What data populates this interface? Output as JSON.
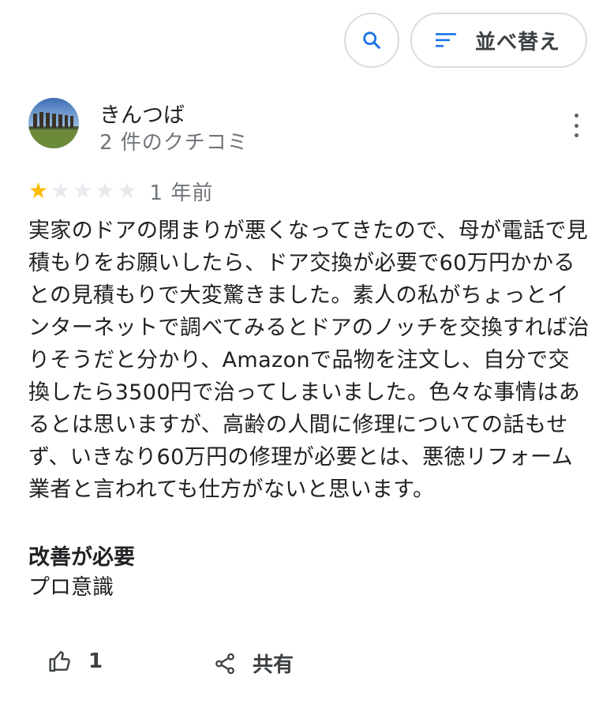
{
  "toolbar": {
    "search_icon": "search-icon",
    "sort_icon": "sort-icon",
    "sort_label": "並べ替え"
  },
  "review": {
    "reviewer_name": "きんつば",
    "review_count": "2 件のクチコミ",
    "rating": 1,
    "max_rating": 5,
    "time_ago": "1 年前",
    "text": "実家のドアの閉まりが悪くなってきたので、母が電話で見積もりをお願いしたら、ドア交換が必要で60万円かかるとの見積もりで大変驚きました。素人の私がちょっとインターネットで調べてみるとドアのノッチを交換すれば治りそうだと分かり、Amazonで品物を注文し、自分で交換したら3500円で治ってしまいました。色々な事情はあるとは思いますが、高齢の人間に修理についての話もせず、いきなり60万円の修理が必要とは、悪徳リフォーム業者と言われても仕方がないと思います。",
    "attribute_title": "改善が必要",
    "attribute_value": "プロ意識",
    "like_count": "1",
    "share_label": "共有"
  },
  "colors": {
    "accent_blue": "#1a73e8",
    "star_filled": "#fbbc04",
    "star_empty": "#e8eaed"
  }
}
